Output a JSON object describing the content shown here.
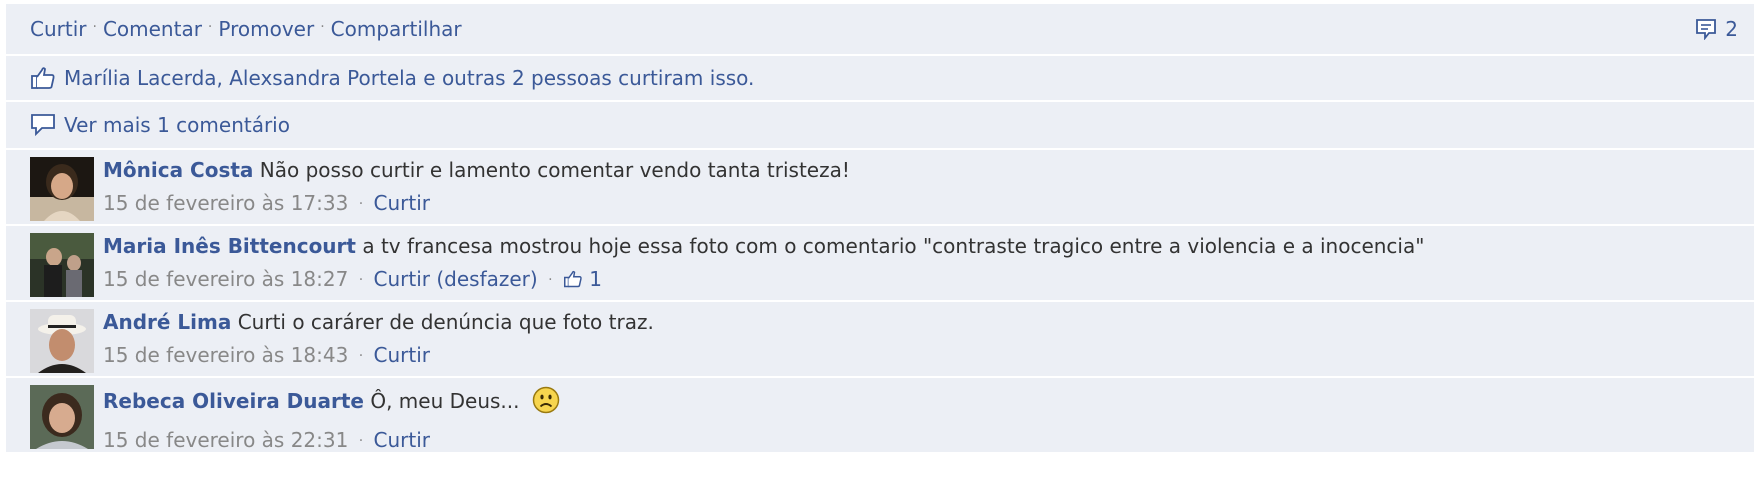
{
  "actions": {
    "like": "Curtir",
    "comment": "Comentar",
    "promote": "Promover",
    "share": "Compartilhar",
    "comment_count": "2"
  },
  "likes": {
    "text": "Marília Lacerda, Alexsandra Portela e outras 2 pessoas curtiram isso."
  },
  "more_comments": {
    "text": "Ver mais 1 comentário"
  },
  "comments": [
    {
      "author": "Mônica Costa",
      "text": "Não posso curtir e lamento comentar vendo tanta tristeza!",
      "time": "15 de fevereiro às 17:33",
      "like": "Curtir"
    },
    {
      "author": "Maria Inês Bittencourt",
      "text": "a tv francesa mostrou hoje essa foto com o comentario \"contraste tragico entre a violencia e a inocencia\"",
      "time": "15 de fevereiro às 18:27",
      "like": "Curtir (desfazer)",
      "like_count": "1"
    },
    {
      "author": "André Lima",
      "text": "Curti o carárer de denúncia que foto traz.",
      "time": "15 de fevereiro às 18:43",
      "like": "Curtir"
    },
    {
      "author": "Rebeca Oliveira Duarte",
      "text": "Ô, meu Deus...",
      "time": "15 de fevereiro às 22:31",
      "like": "Curtir",
      "emoji": "frown-emoticon"
    }
  ],
  "colors": {
    "link": "#3b5998",
    "background": "#eceff5",
    "meta": "#888888"
  }
}
